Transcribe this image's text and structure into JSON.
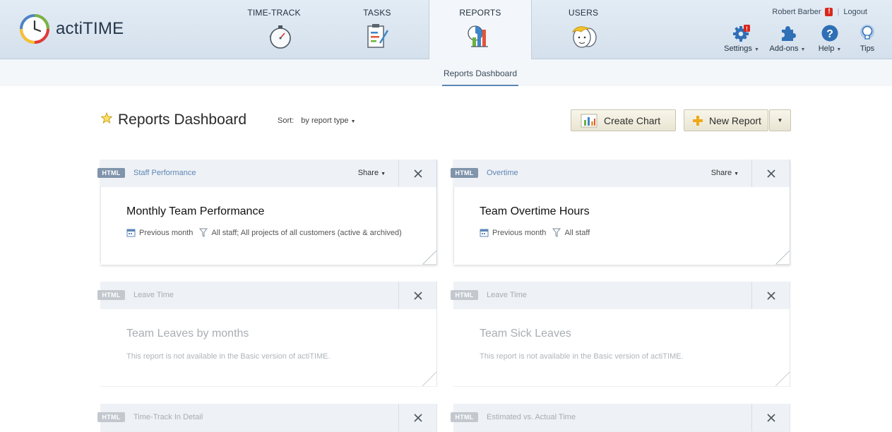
{
  "app": {
    "name": "actiTIME"
  },
  "nav": {
    "tabs": [
      {
        "label": "TIME-TRACK",
        "icon": "stopwatch-icon",
        "active": false
      },
      {
        "label": "TASKS",
        "icon": "task-checklist-icon",
        "active": false
      },
      {
        "label": "REPORTS",
        "icon": "report-charts-icon",
        "active": true
      },
      {
        "label": "USERS",
        "icon": "users-group-icon",
        "active": false
      }
    ]
  },
  "user": {
    "name": "Robert Barber",
    "alert_badge": "!",
    "logout_label": "Logout"
  },
  "tools": {
    "settings": {
      "label": "Settings",
      "icon": "gear-icon",
      "badge": "!"
    },
    "addons": {
      "label": "Add-ons",
      "icon": "puzzle-icon"
    },
    "help": {
      "label": "Help",
      "icon": "help-icon"
    },
    "tips": {
      "label": "Tips",
      "icon": "lightbulb-icon"
    }
  },
  "subnav": {
    "items": [
      {
        "label": "Reports Dashboard",
        "active": true
      }
    ]
  },
  "page": {
    "title": "Reports Dashboard",
    "sort_label": "Sort:",
    "sort_value": "by report type",
    "create_chart_label": "Create Chart",
    "new_report_label": "New Report"
  },
  "cards": [
    {
      "badge": "HTML",
      "type": "Staff Performance",
      "title": "Monthly Team Performance",
      "share_label": "Share",
      "available": true,
      "period": "Previous month",
      "filter": "All staff; All projects of all customers (active & archived)"
    },
    {
      "badge": "HTML",
      "type": "Overtime",
      "title": "Team Overtime Hours",
      "share_label": "Share",
      "available": true,
      "period": "Previous month",
      "filter": "All staff"
    },
    {
      "badge": "HTML",
      "type": "Leave Time",
      "title": "Team Leaves by months",
      "available": false,
      "note": "This report is not available in the Basic version of actiTIME."
    },
    {
      "badge": "HTML",
      "type": "Leave Time",
      "title": "Team Sick Leaves",
      "available": false,
      "note": "This report is not available in the Basic version of actiTIME."
    },
    {
      "badge": "HTML",
      "type": "Time-Track In Detail",
      "available": false
    },
    {
      "badge": "HTML",
      "type": "Estimated vs. Actual Time",
      "available": false
    }
  ],
  "colors": {
    "header_bg": "#d9e4ef",
    "link_blue": "#5d86b6",
    "badge_active": "#8094ab",
    "badge_disabled": "#c2c8ce",
    "alert_red": "#d9271c",
    "button_bg": "#f1eedf"
  }
}
